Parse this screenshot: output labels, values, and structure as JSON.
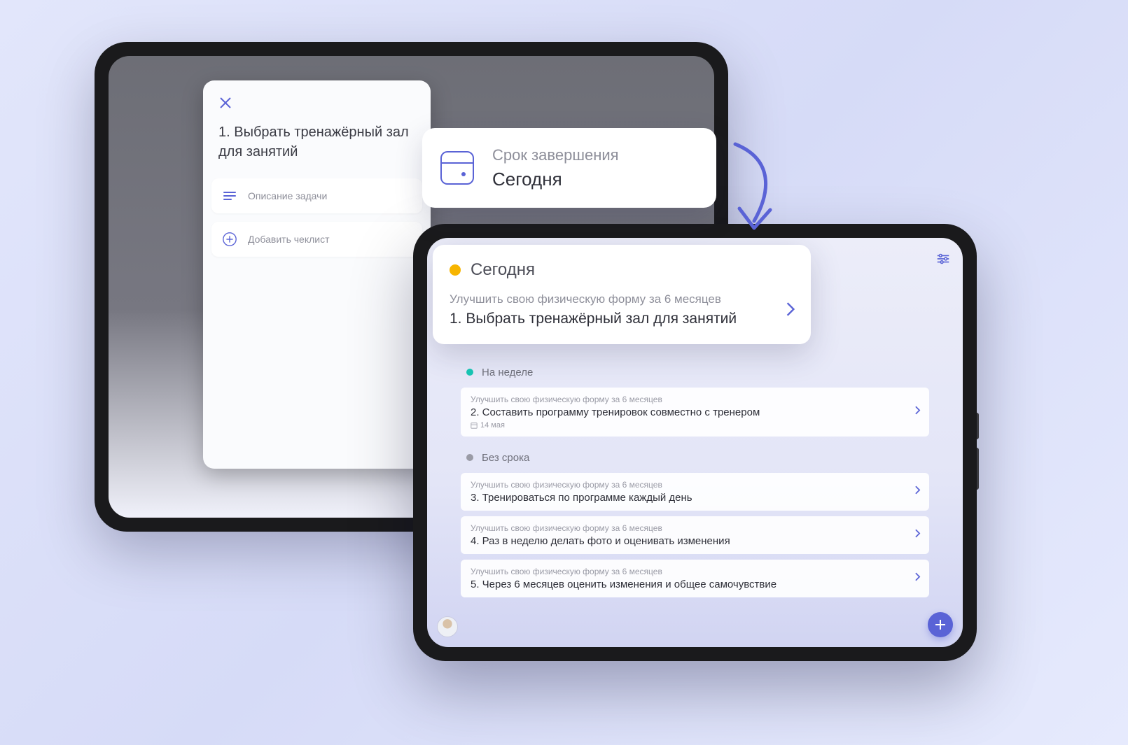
{
  "taskCard": {
    "title": "1. Выбрать тренажёрный зал для занятий",
    "descriptionRow": "Описание задачи",
    "addChecklistRow": "Добавить чеклист"
  },
  "deadline": {
    "label": "Срок завершения",
    "value": "Сегодня"
  },
  "today": {
    "heading": "Сегодня",
    "parent": "Улучшить свою физическую форму за 6 месяцев",
    "task": "1. Выбрать тренажёрный зал для занятий"
  },
  "sections": {
    "week": "На неделе",
    "none": "Без срока"
  },
  "parentGoal": "Улучшить свою физическую форму за 6 месяцев",
  "items": {
    "i2": {
      "title": "2. Составить программу тренировок совместно с тренером",
      "date": "14 мая"
    },
    "i3": {
      "title": "3. Тренироваться по программе каждый день"
    },
    "i4": {
      "title": "4. Раз в неделю делать фото и оценивать изменения"
    },
    "i5": {
      "title": "5. Через 6 месяцев оценить изменения и общее самочувствие"
    }
  }
}
